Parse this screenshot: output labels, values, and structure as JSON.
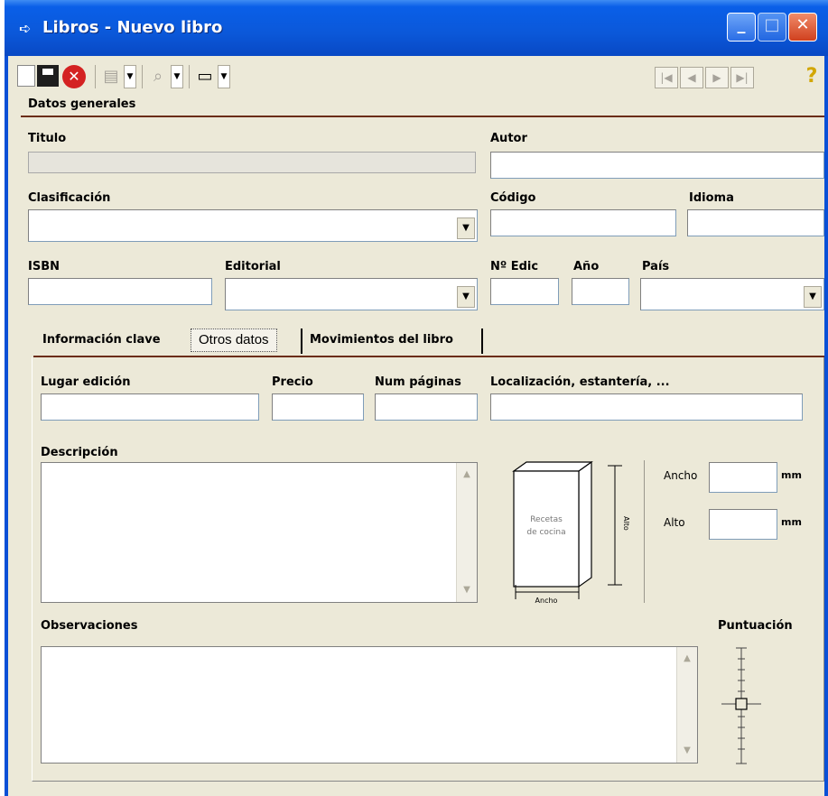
{
  "window": {
    "title": "Libros - Nuevo libro"
  },
  "toolbar": {
    "icons": [
      "new-document-icon",
      "save-icon",
      "cancel-icon",
      "print-icon",
      "find-icon",
      "view-icon"
    ],
    "nav": [
      "|◀",
      "◀",
      "▶",
      "▶|"
    ],
    "help_glyph": "?"
  },
  "general": {
    "section_title": "Datos generales",
    "titulo_label": "Titulo",
    "autor_label": "Autor",
    "clasificacion_label": "Clasificación",
    "codigo_label": "Código",
    "idioma_label": "Idioma",
    "isbn_label": "ISBN",
    "editorial_label": "Editorial",
    "nedic_label": "Nº Edic",
    "anio_label": "Año",
    "pais_label": "País"
  },
  "tabs": [
    {
      "label": "Información clave",
      "active": false
    },
    {
      "label": "Otros datos",
      "active": true
    },
    {
      "label": "Movimientos del libro",
      "active": false
    }
  ],
  "otros": {
    "lugar_label": "Lugar edición",
    "precio_label": "Precio",
    "num_paginas_label": "Num páginas",
    "localizacion_label": "Localización, estantería, ...",
    "descripcion_label": "Descripción",
    "observaciones_label": "Observaciones",
    "puntuacion_label": "Puntuación",
    "ancho_label": "Ancho",
    "alto_label": "Alto",
    "mm_unit": "mm",
    "diagram_book_text": "Recetas de cocina",
    "diagram_alto": "Alto",
    "diagram_ancho": "Ancho"
  },
  "colors": {
    "titlebar": "#0b58d9",
    "divider": "#6b2d16",
    "background": "#ece9d8"
  }
}
